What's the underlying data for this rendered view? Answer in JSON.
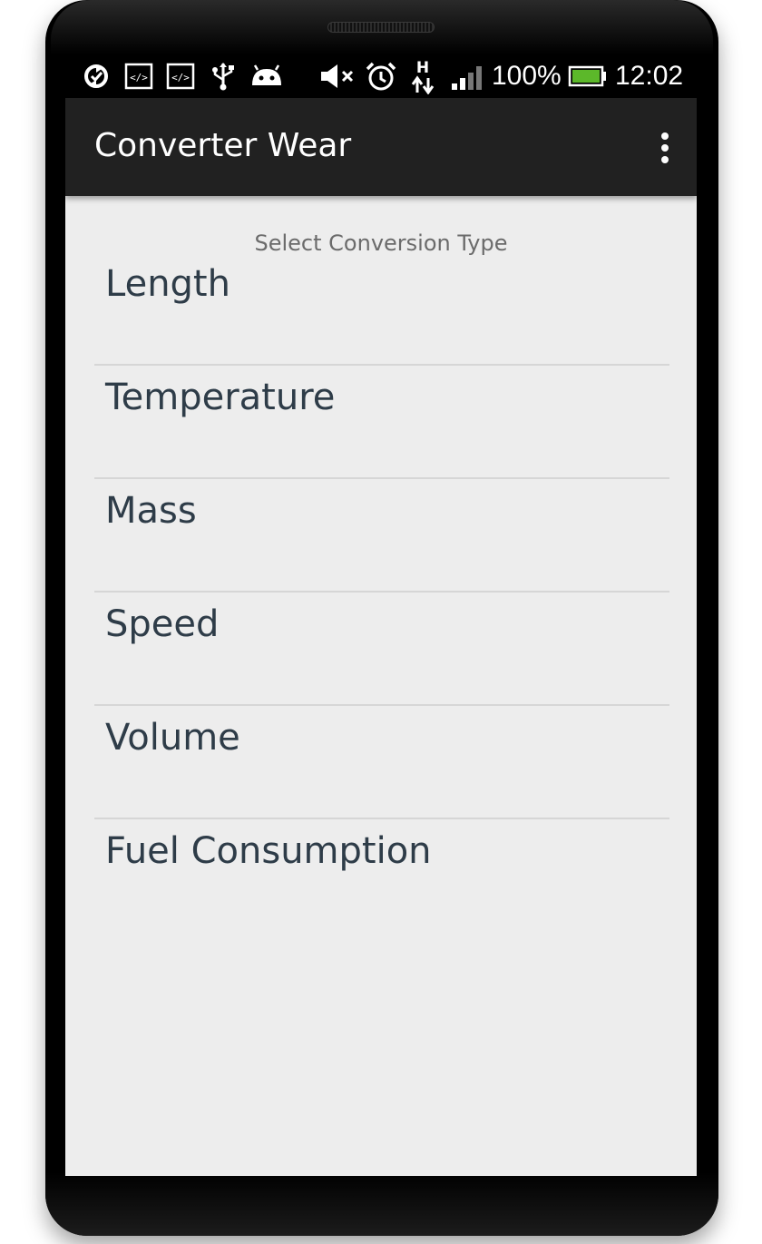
{
  "status_bar": {
    "icons": [
      "sync-icon",
      "code-icon",
      "code-icon",
      "usb-icon",
      "android-icon",
      "mute-icon",
      "alarm-icon",
      "network-h-icon",
      "signal-icon",
      "battery-icon"
    ],
    "battery_percent": "100%",
    "time": "12:02",
    "battery_color": "#5cb82a"
  },
  "action_bar": {
    "title": "Converter Wear",
    "background": "#212121",
    "overflow_icon": "overflow-menu-icon"
  },
  "main": {
    "subtitle": "Select Conversion Type",
    "items": [
      {
        "label": "Length"
      },
      {
        "label": "Temperature"
      },
      {
        "label": "Mass"
      },
      {
        "label": "Speed"
      },
      {
        "label": "Volume"
      },
      {
        "label": "Fuel Consumption"
      }
    ],
    "background": "#ededed"
  }
}
